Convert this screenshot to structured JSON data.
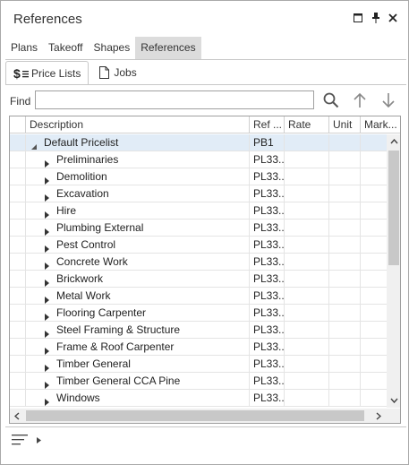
{
  "window": {
    "title": "References",
    "controls": [
      "maximize-icon",
      "pin-icon",
      "close-icon"
    ]
  },
  "top_tabs": [
    {
      "label": "Plans",
      "active": false
    },
    {
      "label": "Takeoff",
      "active": false
    },
    {
      "label": "Shapes",
      "active": false
    },
    {
      "label": "References",
      "active": true
    }
  ],
  "sub_tabs": [
    {
      "label": "Price Lists",
      "icon": "price-list-icon",
      "active": true
    },
    {
      "label": "Jobs",
      "icon": "document-icon",
      "active": false
    }
  ],
  "find": {
    "label": "Find",
    "value": "",
    "placeholder": ""
  },
  "grid": {
    "columns": [
      "Description",
      "Ref ...",
      "Rate",
      "Unit",
      "Mark..."
    ],
    "root": {
      "description": "Default Pricelist",
      "ref": "PB1",
      "expanded": true,
      "selected": true
    },
    "rows": [
      {
        "description": "Preliminaries",
        "ref": "PL33..."
      },
      {
        "description": "Demolition",
        "ref": "PL33..."
      },
      {
        "description": "Excavation",
        "ref": "PL33..."
      },
      {
        "description": "Hire",
        "ref": "PL33..."
      },
      {
        "description": "Plumbing External",
        "ref": "PL33..."
      },
      {
        "description": "Pest Control",
        "ref": "PL33..."
      },
      {
        "description": "Concrete Work",
        "ref": "PL33..."
      },
      {
        "description": "Brickwork",
        "ref": "PL33..."
      },
      {
        "description": "Metal Work",
        "ref": "PL33..."
      },
      {
        "description": "Flooring Carpenter",
        "ref": "PL33..."
      },
      {
        "description": "Steel Framing & Structure",
        "ref": "PL33..."
      },
      {
        "description": "Frame & Roof Carpenter",
        "ref": "PL33..."
      },
      {
        "description": "Timber General",
        "ref": "PL33..."
      },
      {
        "description": "Timber General CCA Pine",
        "ref": "PL33..."
      },
      {
        "description": "Windows",
        "ref": "PL33..."
      }
    ]
  },
  "colors": {
    "selected_row": "#e1ecf7",
    "active_tab": "#dcdcdc",
    "border": "#a9a9a9"
  }
}
